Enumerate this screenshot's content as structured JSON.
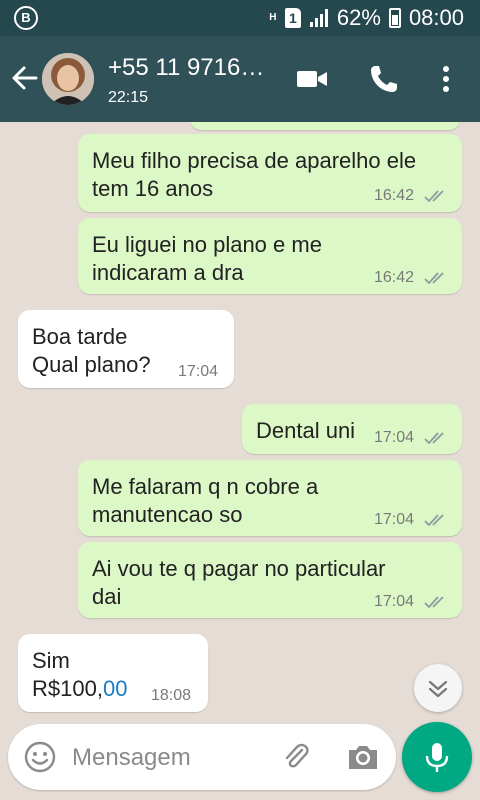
{
  "status_bar": {
    "left_badge": "B",
    "network_type": "H",
    "sim_slot": "1",
    "battery_percent": "62%",
    "time": "08:00",
    "icons": [
      "signal-icon",
      "battery-icon"
    ]
  },
  "header": {
    "contact_name": "+55 11 9716…",
    "contact_status": "22:15",
    "icons": [
      "back-arrow-icon",
      "avatar",
      "video-call-icon",
      "phone-icon",
      "more-options-icon"
    ]
  },
  "messages": [
    {
      "direction": "out",
      "lines": [
        "Meu filho precisa de aparelho ele",
        "tem 16 anos"
      ],
      "time": "16:42",
      "read": true
    },
    {
      "direction": "out",
      "lines": [
        "Eu liguei no plano e me",
        "indicaram a dra"
      ],
      "time": "16:42",
      "read": true
    },
    {
      "direction": "in",
      "lines": [
        "Boa tarde",
        "Qual plano?"
      ],
      "time": "17:04"
    },
    {
      "direction": "out",
      "lines": [
        "Dental uni"
      ],
      "time": "17:04",
      "read": true
    },
    {
      "direction": "out",
      "lines": [
        "Me falaram q n cobre a",
        "manutencao so"
      ],
      "time": "17:04",
      "read": true
    },
    {
      "direction": "out",
      "lines": [
        "Ai vou te q pagar no particular",
        "dai"
      ],
      "time": "17:04",
      "read": true
    },
    {
      "direction": "in",
      "lines": [
        "Sim"
      ],
      "line2_prefix": "R$100,",
      "line2_link": "00",
      "time": "18:08"
    }
  ],
  "composer": {
    "placeholder": "Mensagem",
    "icons": [
      "emoji-icon",
      "attach-icon",
      "camera-icon",
      "mic-icon",
      "scroll-down-icon"
    ]
  },
  "colors": {
    "status_bar": "#25474e",
    "header": "#2f5157",
    "chat_bg": "#e5ddd5",
    "outgoing_bubble": "#dcf8c6",
    "incoming_bubble": "#ffffff",
    "mic_button": "#00a884",
    "link": "#1a7cc2"
  }
}
